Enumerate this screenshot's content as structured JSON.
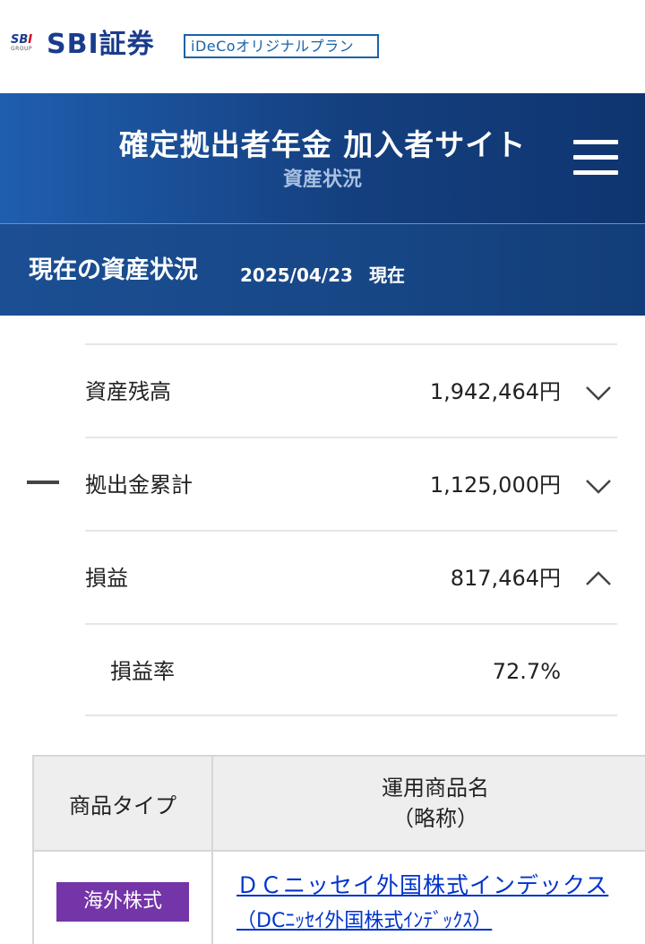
{
  "brand": {
    "group_mark": "SBI",
    "group_text": "GROUP",
    "name": "SBI証券",
    "plan": "iDeCoオリジナルプラン"
  },
  "header": {
    "title": "確定拠出者年金 加入者サイト",
    "subtitle": "資産状況",
    "menu_icon": "hamburger-menu-icon"
  },
  "status": {
    "title": "現在の資産状況",
    "date": "2025/04/23",
    "suffix": "現在"
  },
  "summary": {
    "rows": [
      {
        "label": "資産残高",
        "value": "1,942,464円",
        "chevron": "down"
      },
      {
        "label": "拠出金累計",
        "value": "1,125,000円",
        "chevron": "down"
      },
      {
        "label": "損益",
        "value": "817,464円",
        "chevron": "up"
      },
      {
        "label": "損益率",
        "value": "72.7%"
      }
    ]
  },
  "table": {
    "headers": {
      "type": "商品タイプ",
      "name_line1": "運用商品名",
      "name_line2": "（略称）"
    },
    "rows": [
      {
        "type": "海外株式",
        "type_color": "#7435a8",
        "name": "ＤＣニッセイ外国株式インデックス",
        "short_name": "（DCﾆｯｾｲ外国株式ｲﾝﾃﾞｯｸｽ）"
      }
    ]
  },
  "colors": {
    "brand_blue": "#1a3c8c",
    "header_blue": "#143f7e",
    "link_blue": "#0033cc"
  }
}
